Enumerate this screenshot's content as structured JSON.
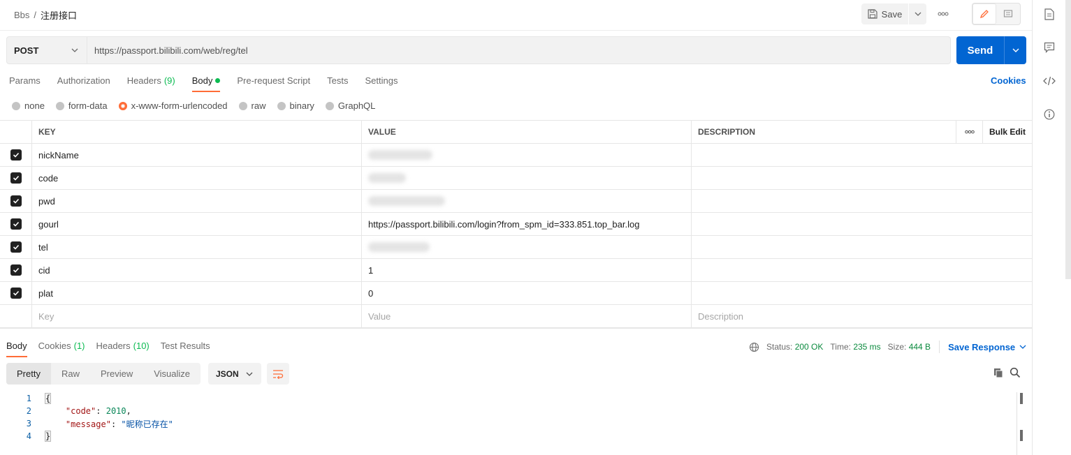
{
  "header": {
    "breadcrumb_parent": "Bbs",
    "breadcrumb_sep": "/",
    "breadcrumb_current": "注册接口",
    "save_label": "Save"
  },
  "request": {
    "method": "POST",
    "url": "https://passport.bilibili.com/web/reg/tel",
    "send_label": "Send"
  },
  "req_tabs": [
    {
      "label": "Params",
      "count": ""
    },
    {
      "label": "Authorization",
      "count": ""
    },
    {
      "label": "Headers",
      "count": "(9)"
    },
    {
      "label": "Body",
      "count": ""
    },
    {
      "label": "Pre-request Script",
      "count": ""
    },
    {
      "label": "Tests",
      "count": ""
    },
    {
      "label": "Settings",
      "count": ""
    }
  ],
  "cookies_link": "Cookies",
  "body_types": [
    "none",
    "form-data",
    "x-www-form-urlencoded",
    "raw",
    "binary",
    "GraphQL"
  ],
  "body_type_selected": "x-www-form-urlencoded",
  "table": {
    "col_key": "KEY",
    "col_value": "VALUE",
    "col_desc": "DESCRIPTION",
    "bulk_edit": "Bulk Edit",
    "rows": [
      {
        "key": "nickName",
        "value": "",
        "checked": true
      },
      {
        "key": "code",
        "value": "",
        "checked": true
      },
      {
        "key": "pwd",
        "value": "",
        "checked": true
      },
      {
        "key": "gourl",
        "value": "https://passport.bilibili.com/login?from_spm_id=333.851.top_bar.log",
        "checked": true
      },
      {
        "key": "tel",
        "value": "",
        "checked": true
      },
      {
        "key": "cid",
        "value": "1",
        "checked": true
      },
      {
        "key": "plat",
        "value": "0",
        "checked": true
      }
    ],
    "placeholder_key": "Key",
    "placeholder_value": "Value",
    "placeholder_desc": "Description"
  },
  "response": {
    "tabs": [
      {
        "label": "Body",
        "count": ""
      },
      {
        "label": "Cookies",
        "count": "(1)"
      },
      {
        "label": "Headers",
        "count": "(10)"
      },
      {
        "label": "Test Results",
        "count": ""
      }
    ],
    "status_label": "Status:",
    "status_value": "200 OK",
    "time_label": "Time:",
    "time_value": "235 ms",
    "size_label": "Size:",
    "size_value": "444 B",
    "save_response": "Save Response",
    "views": [
      "Pretty",
      "Raw",
      "Preview",
      "Visualize"
    ],
    "format": "JSON",
    "code_lines": [
      {
        "n": "1",
        "t": "{"
      },
      {
        "n": "2",
        "key": "\"code\"",
        "num": "2010",
        "tail": ","
      },
      {
        "n": "3",
        "key": "\"message\"",
        "str": "\"昵称已存在\""
      },
      {
        "n": "4",
        "t": "}"
      }
    ]
  },
  "colors": {
    "accent": "#ff6c37",
    "send": "#0265d2",
    "success": "#0cbb52"
  }
}
